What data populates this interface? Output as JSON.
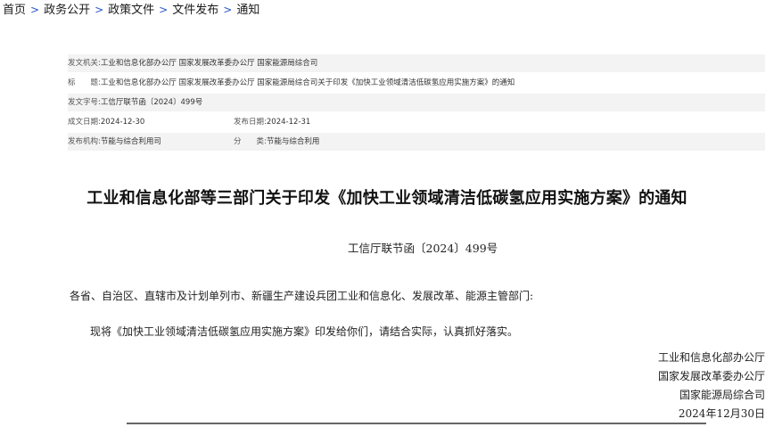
{
  "breadcrumb": {
    "items": [
      "首页",
      "政务公开",
      "政策文件",
      "文件发布",
      "通知"
    ],
    "separator": ">"
  },
  "meta": {
    "issuer_label": "发文机关:",
    "issuer_value": "工业和信息化部办公厅 国家发展改革委办公厅 国家能源局综合司",
    "title_label": "标　　题:",
    "title_value": "工业和信息化部办公厅 国家发展改革委办公厅 国家能源局综合司关于印发《加快工业领域清洁低碳氢应用实施方案》的通知",
    "docno_label": "发文字号:",
    "docno_value": "工信厅联节函〔2024〕499号",
    "written_label": "成文日期:",
    "written_value": "2024-12-30",
    "published_label": "发布日期:",
    "published_value": "2024-12-31",
    "org_label": "发布机构:",
    "org_value": "节能与综合利用司",
    "category_label": "分　　类:",
    "category_value": "节能与综合利用"
  },
  "document": {
    "title": "工业和信息化部等三部门关于印发《加快工业领域清洁低碳氢应用实施方案》的通知",
    "number": "工信厅联节函〔2024〕499号",
    "addressee": "各省、自治区、直辖市及计划单列市、新疆生产建设兵团工业和信息化、发展改革、能源主管部门:",
    "body": "现将《加快工业领域清洁低碳氢应用实施方案》印发给你们，请结合实际，认真抓好落实。",
    "signatories": [
      "工业和信息化部办公厅",
      "国家发展改革委办公厅",
      "国家能源局综合司"
    ],
    "date": "2024年12月30日"
  },
  "colors": {
    "separator": "#2a56c6",
    "meta_shade": "#f3f3f3"
  }
}
